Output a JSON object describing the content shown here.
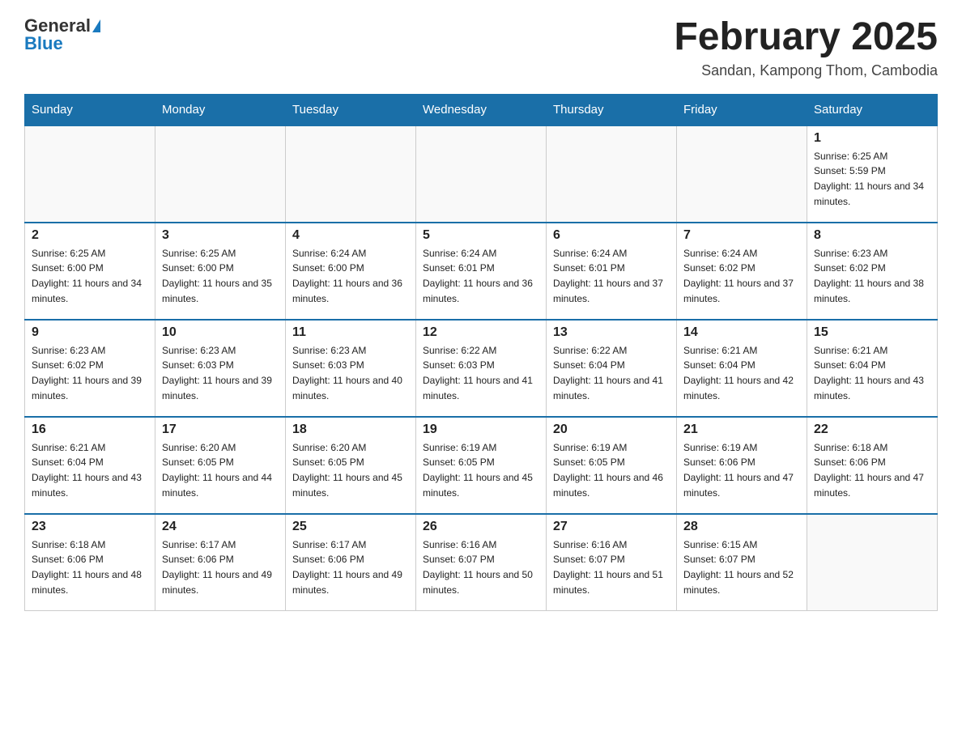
{
  "header": {
    "logo_general": "General",
    "logo_blue": "Blue",
    "month_title": "February 2025",
    "location": "Sandan, Kampong Thom, Cambodia"
  },
  "days_of_week": [
    "Sunday",
    "Monday",
    "Tuesday",
    "Wednesday",
    "Thursday",
    "Friday",
    "Saturday"
  ],
  "weeks": [
    [
      {
        "day": "",
        "info": ""
      },
      {
        "day": "",
        "info": ""
      },
      {
        "day": "",
        "info": ""
      },
      {
        "day": "",
        "info": ""
      },
      {
        "day": "",
        "info": ""
      },
      {
        "day": "",
        "info": ""
      },
      {
        "day": "1",
        "info": "Sunrise: 6:25 AM\nSunset: 5:59 PM\nDaylight: 11 hours and 34 minutes."
      }
    ],
    [
      {
        "day": "2",
        "info": "Sunrise: 6:25 AM\nSunset: 6:00 PM\nDaylight: 11 hours and 34 minutes."
      },
      {
        "day": "3",
        "info": "Sunrise: 6:25 AM\nSunset: 6:00 PM\nDaylight: 11 hours and 35 minutes."
      },
      {
        "day": "4",
        "info": "Sunrise: 6:24 AM\nSunset: 6:00 PM\nDaylight: 11 hours and 36 minutes."
      },
      {
        "day": "5",
        "info": "Sunrise: 6:24 AM\nSunset: 6:01 PM\nDaylight: 11 hours and 36 minutes."
      },
      {
        "day": "6",
        "info": "Sunrise: 6:24 AM\nSunset: 6:01 PM\nDaylight: 11 hours and 37 minutes."
      },
      {
        "day": "7",
        "info": "Sunrise: 6:24 AM\nSunset: 6:02 PM\nDaylight: 11 hours and 37 minutes."
      },
      {
        "day": "8",
        "info": "Sunrise: 6:23 AM\nSunset: 6:02 PM\nDaylight: 11 hours and 38 minutes."
      }
    ],
    [
      {
        "day": "9",
        "info": "Sunrise: 6:23 AM\nSunset: 6:02 PM\nDaylight: 11 hours and 39 minutes."
      },
      {
        "day": "10",
        "info": "Sunrise: 6:23 AM\nSunset: 6:03 PM\nDaylight: 11 hours and 39 minutes."
      },
      {
        "day": "11",
        "info": "Sunrise: 6:23 AM\nSunset: 6:03 PM\nDaylight: 11 hours and 40 minutes."
      },
      {
        "day": "12",
        "info": "Sunrise: 6:22 AM\nSunset: 6:03 PM\nDaylight: 11 hours and 41 minutes."
      },
      {
        "day": "13",
        "info": "Sunrise: 6:22 AM\nSunset: 6:04 PM\nDaylight: 11 hours and 41 minutes."
      },
      {
        "day": "14",
        "info": "Sunrise: 6:21 AM\nSunset: 6:04 PM\nDaylight: 11 hours and 42 minutes."
      },
      {
        "day": "15",
        "info": "Sunrise: 6:21 AM\nSunset: 6:04 PM\nDaylight: 11 hours and 43 minutes."
      }
    ],
    [
      {
        "day": "16",
        "info": "Sunrise: 6:21 AM\nSunset: 6:04 PM\nDaylight: 11 hours and 43 minutes."
      },
      {
        "day": "17",
        "info": "Sunrise: 6:20 AM\nSunset: 6:05 PM\nDaylight: 11 hours and 44 minutes."
      },
      {
        "day": "18",
        "info": "Sunrise: 6:20 AM\nSunset: 6:05 PM\nDaylight: 11 hours and 45 minutes."
      },
      {
        "day": "19",
        "info": "Sunrise: 6:19 AM\nSunset: 6:05 PM\nDaylight: 11 hours and 45 minutes."
      },
      {
        "day": "20",
        "info": "Sunrise: 6:19 AM\nSunset: 6:05 PM\nDaylight: 11 hours and 46 minutes."
      },
      {
        "day": "21",
        "info": "Sunrise: 6:19 AM\nSunset: 6:06 PM\nDaylight: 11 hours and 47 minutes."
      },
      {
        "day": "22",
        "info": "Sunrise: 6:18 AM\nSunset: 6:06 PM\nDaylight: 11 hours and 47 minutes."
      }
    ],
    [
      {
        "day": "23",
        "info": "Sunrise: 6:18 AM\nSunset: 6:06 PM\nDaylight: 11 hours and 48 minutes."
      },
      {
        "day": "24",
        "info": "Sunrise: 6:17 AM\nSunset: 6:06 PM\nDaylight: 11 hours and 49 minutes."
      },
      {
        "day": "25",
        "info": "Sunrise: 6:17 AM\nSunset: 6:06 PM\nDaylight: 11 hours and 49 minutes."
      },
      {
        "day": "26",
        "info": "Sunrise: 6:16 AM\nSunset: 6:07 PM\nDaylight: 11 hours and 50 minutes."
      },
      {
        "day": "27",
        "info": "Sunrise: 6:16 AM\nSunset: 6:07 PM\nDaylight: 11 hours and 51 minutes."
      },
      {
        "day": "28",
        "info": "Sunrise: 6:15 AM\nSunset: 6:07 PM\nDaylight: 11 hours and 52 minutes."
      },
      {
        "day": "",
        "info": ""
      }
    ]
  ]
}
